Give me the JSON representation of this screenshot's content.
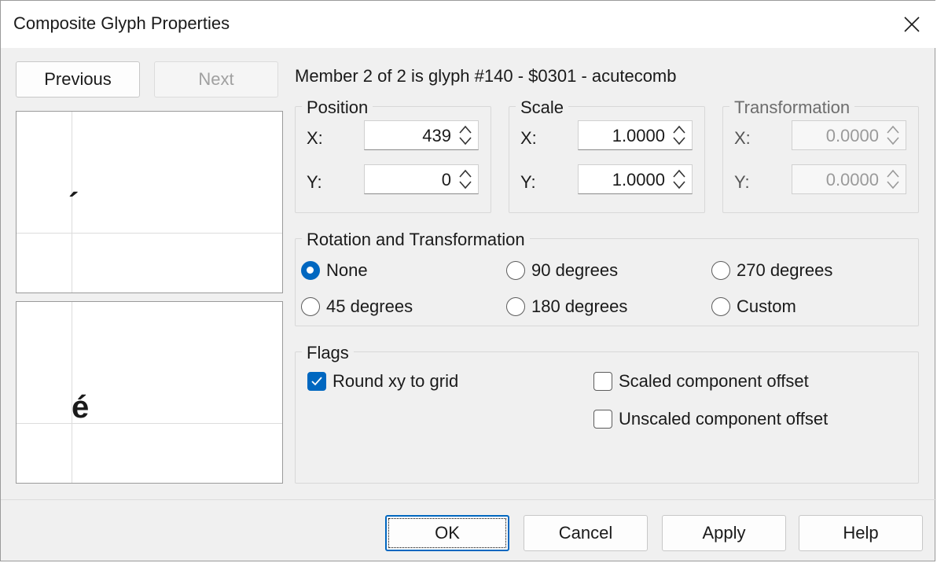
{
  "window": {
    "title": "Composite Glyph Properties"
  },
  "nav": {
    "previous": "Previous",
    "next": "Next"
  },
  "preview": {
    "component_glyph": "´",
    "composite_glyph": "é"
  },
  "member_info": "Member 2 of 2 is glyph #140 - $0301 - acutecomb",
  "position": {
    "label": "Position",
    "x_label": "X:",
    "y_label": "Y:",
    "x": "439",
    "y": "0"
  },
  "scale": {
    "label": "Scale",
    "x_label": "X:",
    "y_label": "Y:",
    "x": "1.0000",
    "y": "1.0000"
  },
  "transformation": {
    "label": "Transformation",
    "x_label": "X:",
    "y_label": "Y:",
    "x": "0.0000",
    "y": "0.0000"
  },
  "rotation": {
    "label": "Rotation and Transformation",
    "selected": "None",
    "options": [
      "None",
      "90 degrees",
      "270 degrees",
      "45 degrees",
      "180 degrees",
      "Custom"
    ]
  },
  "flags": {
    "label": "Flags",
    "round_xy": {
      "label": "Round xy to grid",
      "checked": true
    },
    "scaled_offset": {
      "label": "Scaled component offset",
      "checked": false
    },
    "unscaled_offset": {
      "label": "Unscaled component offset",
      "checked": false
    }
  },
  "buttons": {
    "ok": "OK",
    "cancel": "Cancel",
    "apply": "Apply",
    "help": "Help"
  },
  "colors": {
    "accent": "#0067c0",
    "dialog_bg": "#f0f0f0"
  }
}
